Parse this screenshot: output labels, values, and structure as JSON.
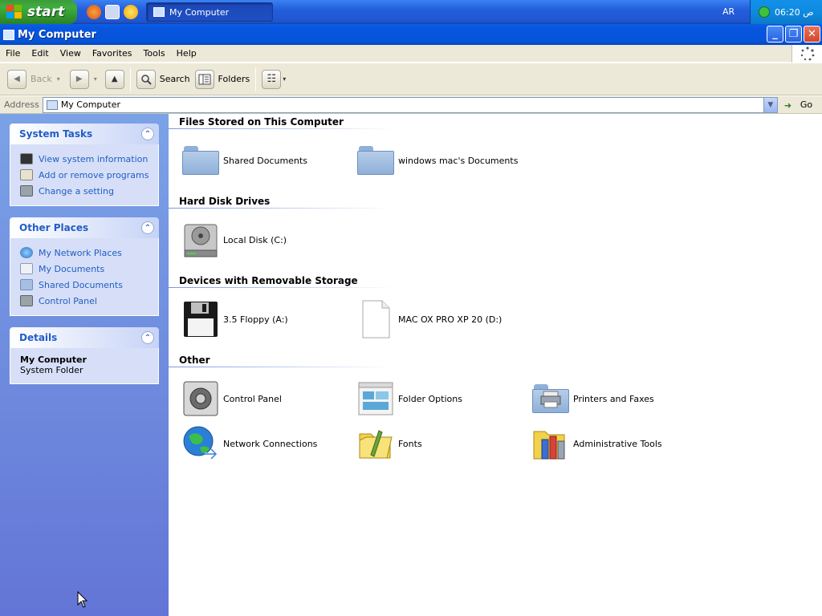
{
  "taskbar": {
    "start_label": "start",
    "task_title": "My Computer",
    "language": "AR",
    "clock": "ص 06:20"
  },
  "window": {
    "title": "My Computer",
    "min_symbol": "_",
    "max_symbol": "❐",
    "close_symbol": "✕"
  },
  "menu": [
    "File",
    "Edit",
    "View",
    "Favorites",
    "Tools",
    "Help"
  ],
  "toolbar": {
    "back_label": "Back",
    "forward_symbol": "▶",
    "back_symbol": "◀",
    "up_symbol": "▲",
    "search_label": "Search",
    "folders_label": "Folders",
    "dropdown_symbol": "▾",
    "views_symbol": "☷"
  },
  "address": {
    "label": "Address",
    "value": "My Computer",
    "dropdown_symbol": "▼",
    "go_label": "Go",
    "go_symbol": "➜"
  },
  "left_panel": {
    "collapse_symbol": "⌃",
    "system_tasks": {
      "title": "System Tasks",
      "items": [
        "View system information",
        "Add or remove programs",
        "Change a setting"
      ]
    },
    "other_places": {
      "title": "Other Places",
      "items": [
        "My Network Places",
        "My Documents",
        "Shared Documents",
        "Control Panel"
      ]
    },
    "details": {
      "title": "Details",
      "name": "My Computer",
      "type": "System Folder"
    }
  },
  "groups": {
    "files_stored": {
      "title": "Files Stored on This Computer",
      "items": [
        "Shared Documents",
        "windows mac's Documents"
      ]
    },
    "hard_disks": {
      "title": "Hard Disk Drives",
      "items": [
        "Local Disk (C:)"
      ]
    },
    "removable": {
      "title": "Devices with Removable Storage",
      "items": [
        "3.5 Floppy (A:)",
        "MAC OX PRO XP 20 (D:)"
      ]
    },
    "other": {
      "title": "Other",
      "items": [
        "Control Panel",
        "Folder Options",
        "Printers and Faxes",
        "Network Connections",
        "Fonts",
        "Administrative Tools"
      ]
    }
  },
  "colors": {
    "accent": "#215dc6",
    "titlebar": "#0654d8",
    "panel": "#6375d6"
  }
}
